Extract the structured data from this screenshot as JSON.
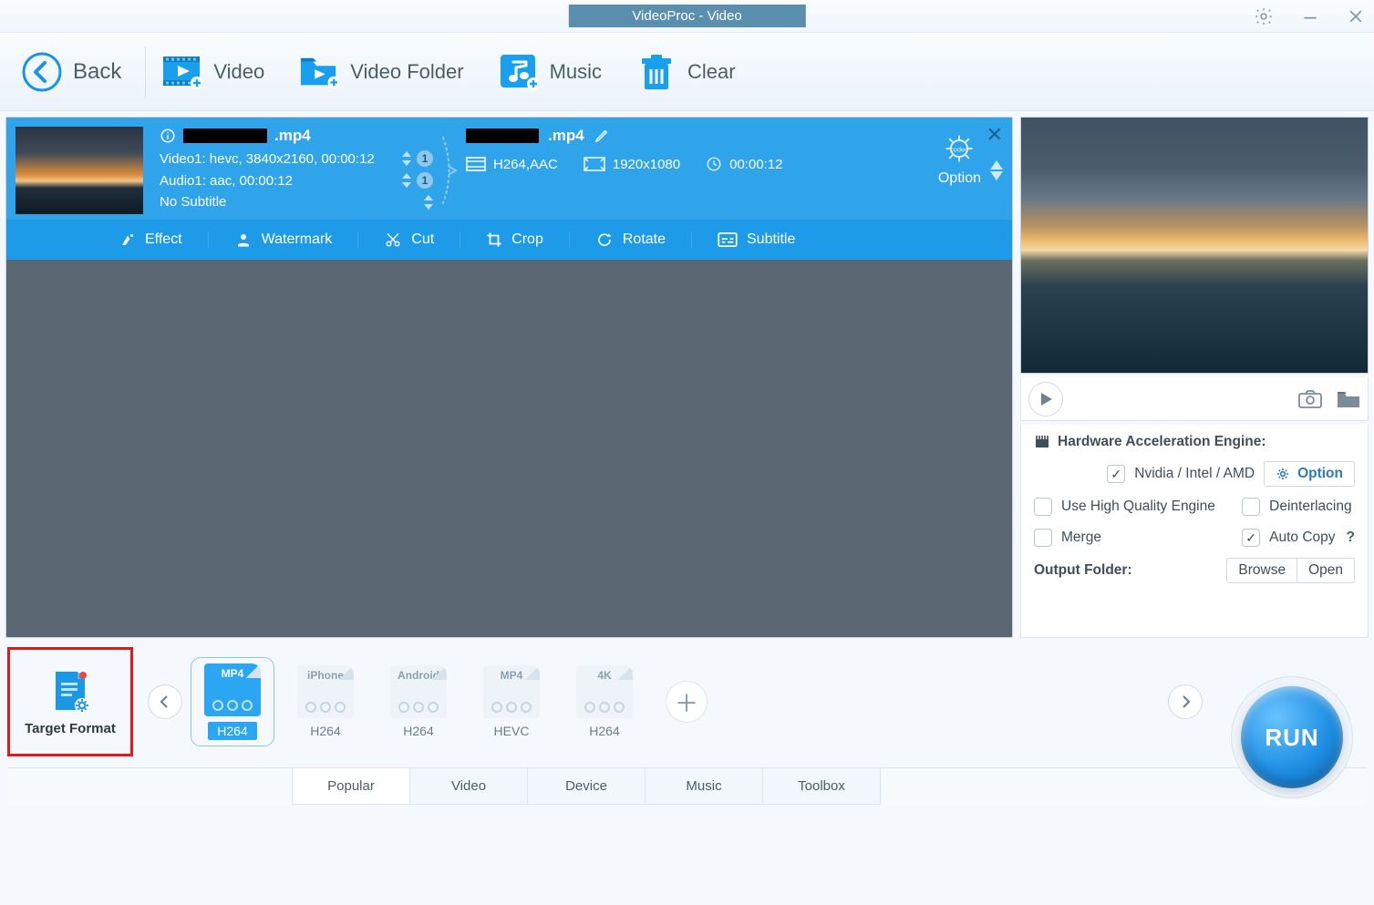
{
  "titlebar": {
    "title": "VideoProc - Video"
  },
  "toolbar": {
    "back": "Back",
    "video": "Video",
    "video_folder": "Video Folder",
    "music": "Music",
    "clear": "Clear"
  },
  "queue_item": {
    "source": {
      "filename_suffix": ".mp4",
      "video_line": "Video1: hevc, 3840x2160, 00:00:12",
      "video_badge": "1",
      "audio_line": "Audio1: aac, 00:00:12",
      "audio_badge": "1",
      "subtitle_line": "No Subtitle"
    },
    "output": {
      "filename_suffix": ".mp4",
      "codec": "H264,AAC",
      "resolution": "1920x1080",
      "duration": "00:00:12",
      "option_label": "Option"
    },
    "actions": {
      "effect": "Effect",
      "watermark": "Watermark",
      "cut": "Cut",
      "crop": "Crop",
      "rotate": "Rotate",
      "subtitle": "Subtitle"
    }
  },
  "preview": {
    "hw_title": "Hardware Acceleration Engine:",
    "nvidia_label": "Nvidia / Intel / AMD",
    "option_btn": "Option",
    "high_quality": "Use High Quality Engine",
    "deinterlace": "Deinterlacing",
    "merge": "Merge",
    "auto_copy": "Auto Copy",
    "output_folder_label": "Output Folder:",
    "browse": "Browse",
    "open": "Open"
  },
  "formats": {
    "target_label": "Target Format",
    "items": [
      {
        "top": "MP4",
        "sub": "H264",
        "active": true
      },
      {
        "top": "iPhone",
        "sub": "H264",
        "active": false
      },
      {
        "top": "Android",
        "sub": "H264",
        "active": false
      },
      {
        "top": "MP4",
        "sub": "HEVC",
        "active": false
      },
      {
        "top": "4K",
        "sub": "H264",
        "active": false
      }
    ]
  },
  "tabs": [
    "Popular",
    "Video",
    "Device",
    "Music",
    "Toolbox"
  ],
  "run_label": "RUN"
}
